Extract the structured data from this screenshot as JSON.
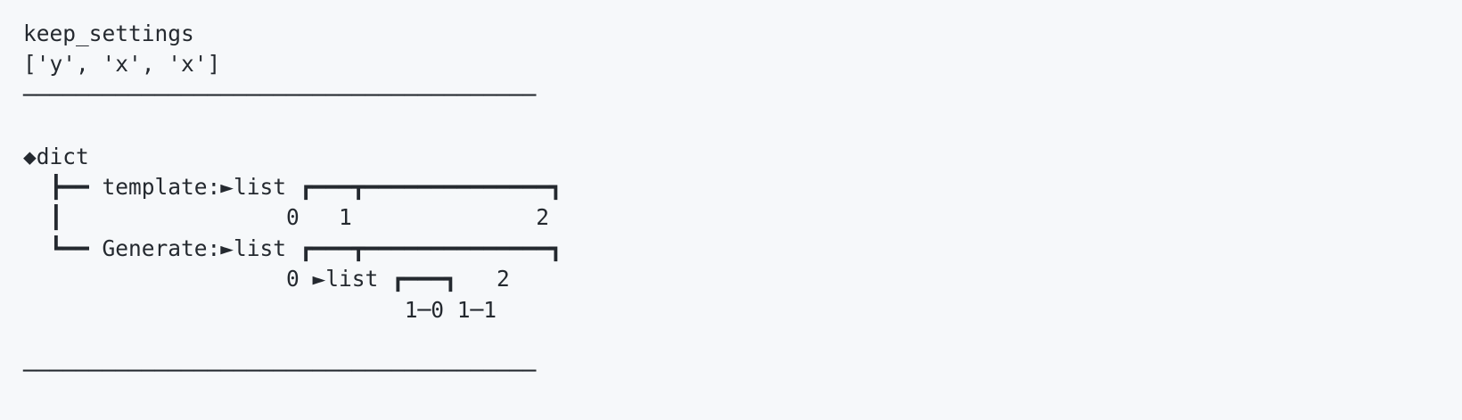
{
  "output": {
    "title": "keep_settings",
    "value": "['y', 'x', 'x']",
    "separator_top": "───────────────────────────────────────",
    "blank_1": "",
    "root": "◆dict",
    "tree_line_1": "  ┣━━ template:►list ┏━━━┳━━━━━━━━━━━━━━┓",
    "tree_line_2": "  ┃                 0   1              2",
    "tree_line_3": "  ┗━━ Generate:►list ┏━━━┳━━━━━━━━━━━━━━┓",
    "tree_line_4": "                    0 ►list ┏━━━┓   2",
    "tree_line_5": "                             1─0 1─1",
    "blank_2": "",
    "separator_bottom": "───────────────────────────────────────"
  }
}
